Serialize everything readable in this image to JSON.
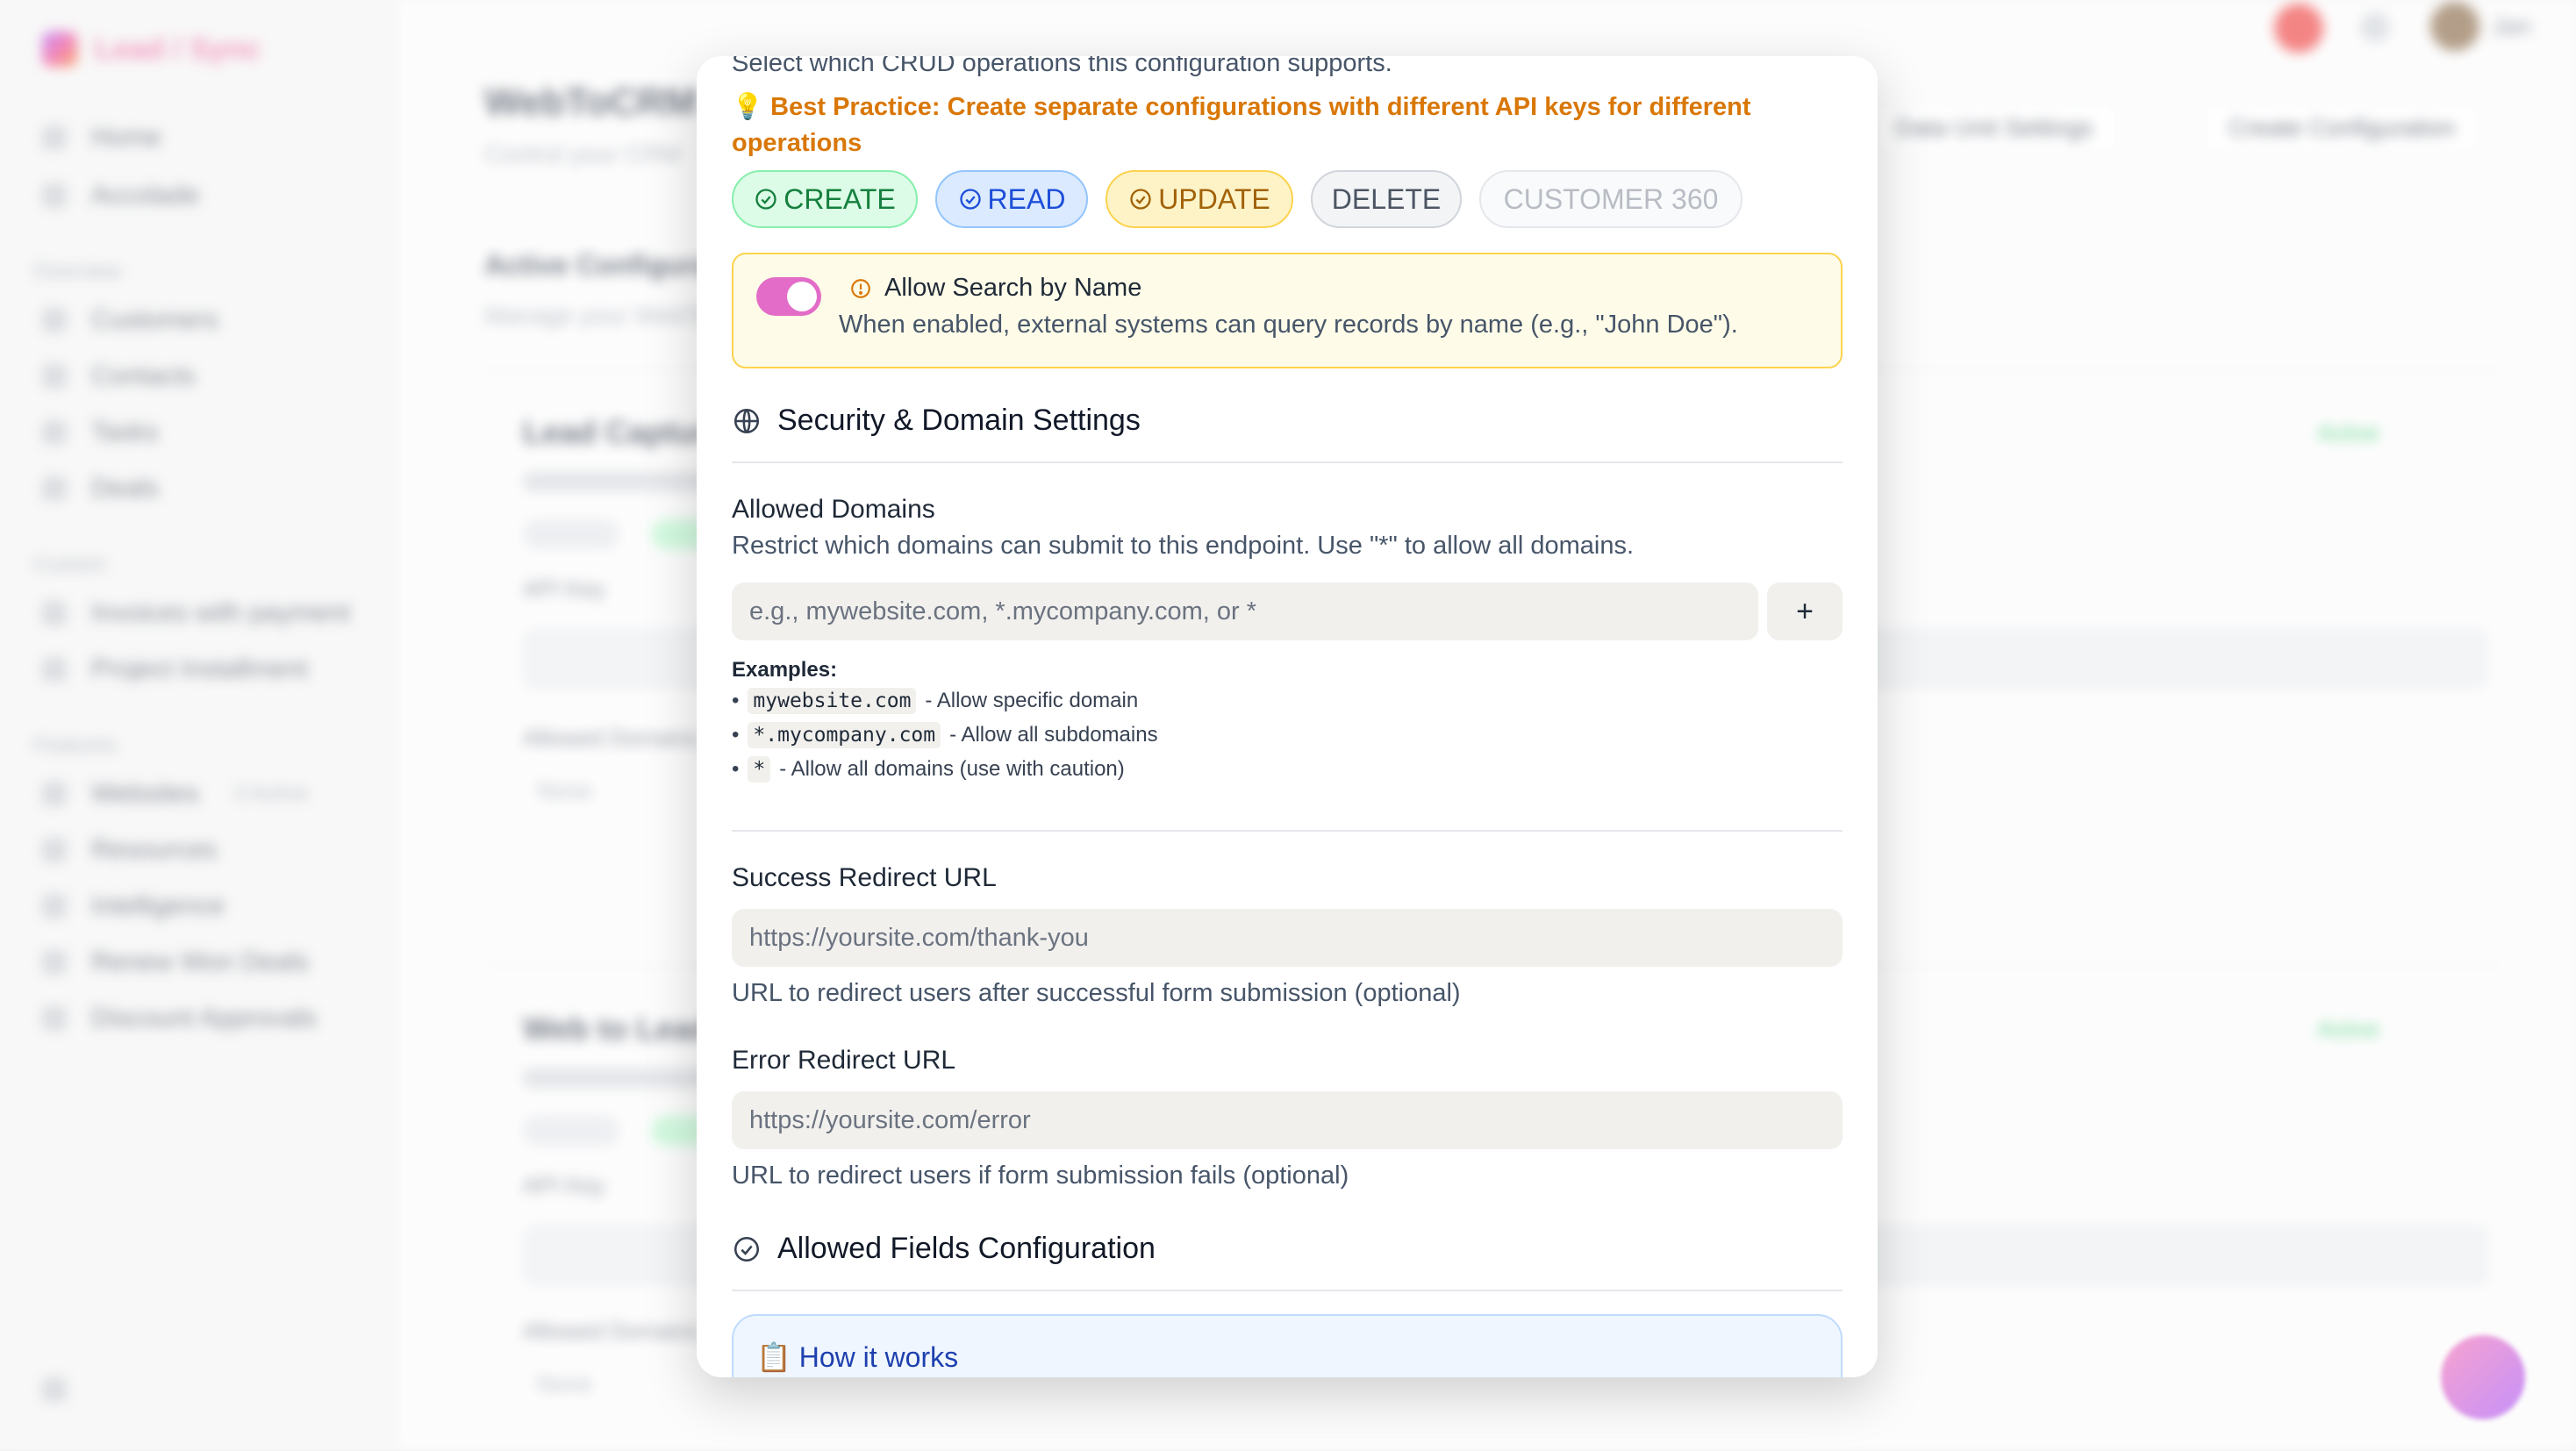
{
  "background": {
    "app_name": "Lead / Sync",
    "page_title": "WebToCRM",
    "page_subtitle": "Control your CRM",
    "header_buttons": [
      "Data Unit Settings",
      "Create Configuration"
    ],
    "sidebar_items": [
      "Home",
      "Accolade"
    ],
    "sidebar_section_1": "Overview",
    "sidebar_group_1": [
      "Customers",
      "Contacts",
      "Tasks",
      "Deals"
    ],
    "sidebar_section_2": "Custom",
    "sidebar_group_2": [
      "Invoices with payment",
      "Project Installment"
    ],
    "sidebar_section_3": "Features",
    "sidebar_group_3": [
      "Websites",
      "Resources",
      "Intelligence",
      "Renew Won Deals",
      "Discount Approvals"
    ],
    "websites_badge": "3 Active",
    "active_section": "Active Configurations",
    "active_section_sub": "Manage your WebToCRM",
    "cards": [
      {
        "title": "Lead Capture",
        "status": "Active",
        "api_label": "API Key",
        "domains_label": "Allowed Domains",
        "domains_value": "None"
      },
      {
        "title": "Web to Lead",
        "status": "Active",
        "api_label": "API Key",
        "domains_label": "Allowed Domains",
        "domains_value": "None"
      }
    ],
    "user_name": "Jan"
  },
  "modal": {
    "crud_description": "Select which CRUD operations this configuration supports.",
    "best_practice": "💡 Best Practice: Create separate configurations with different API keys for different operations",
    "operations": {
      "create": "CREATE",
      "read": "READ",
      "update": "UPDATE",
      "delete": "DELETE",
      "customer360": "CUSTOMER 360"
    },
    "search_by_name": {
      "title": "Allow Search by Name",
      "description": "When enabled, external systems can query records by name (e.g., \"John Doe\").",
      "enabled": true
    },
    "security_section": "Security & Domain Settings",
    "allowed_domains": {
      "label": "Allowed Domains",
      "description": "Restrict which domains can submit to this endpoint. Use \"*\" to allow all domains.",
      "placeholder": "e.g., mywebsite.com, *.mycompany.com, or *",
      "add_label": "+",
      "examples_title": "Examples:",
      "examples": [
        {
          "code": "mywebsite.com",
          "text": "- Allow specific domain"
        },
        {
          "code": "*.mycompany.com",
          "text": "- Allow all subdomains"
        },
        {
          "code": "*",
          "text": "- Allow all domains (use with caution)"
        }
      ]
    },
    "success_redirect": {
      "label": "Success Redirect URL",
      "placeholder": "https://yoursite.com/thank-you",
      "hint": "URL to redirect users after successful form submission (optional)"
    },
    "error_redirect": {
      "label": "Error Redirect URL",
      "placeholder": "https://yoursite.com/error",
      "hint": "URL to redirect users if form submission fails (optional)"
    },
    "fields_section": "Allowed Fields Configuration",
    "how_it_works": "📋 How it works"
  },
  "colors": {
    "create": "#15803d",
    "read": "#1d4ed8",
    "update": "#a16207",
    "warning": "#d97706",
    "toggle": "#e26cc7"
  }
}
